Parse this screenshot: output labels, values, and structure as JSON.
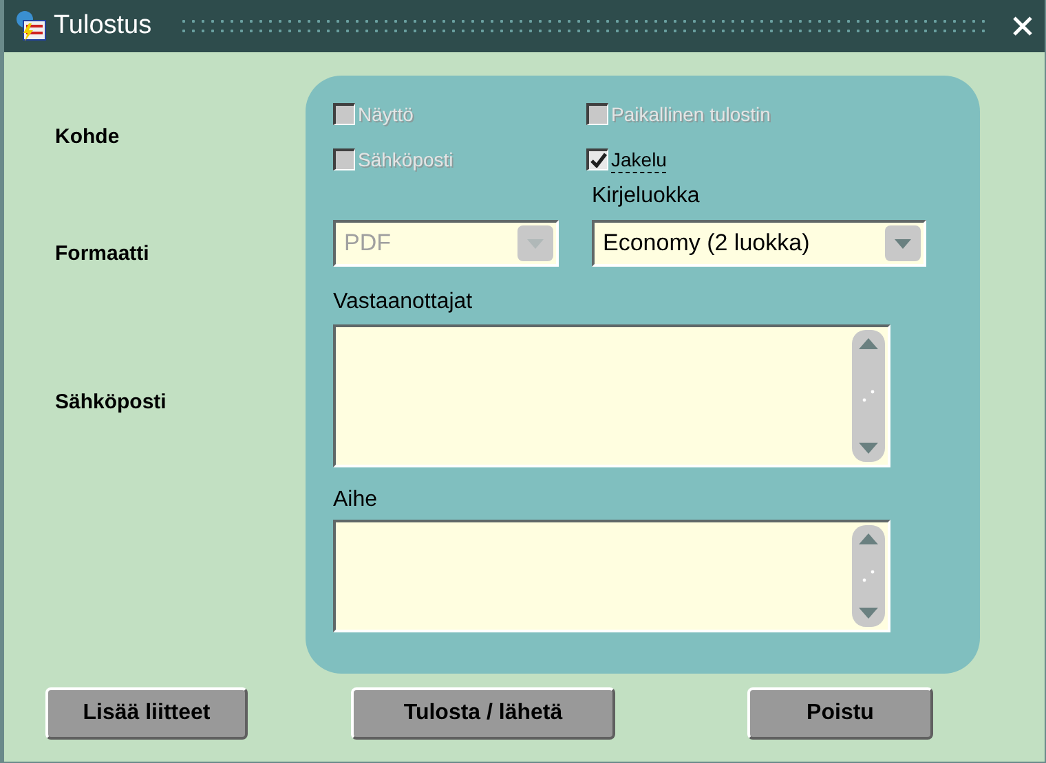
{
  "window": {
    "title": "Tulostus"
  },
  "rows": [
    {
      "label": "Kohde"
    },
    {
      "label": "Formaatti"
    },
    {
      "label": "Sähköposti"
    }
  ],
  "destinations": [
    {
      "label": "Näyttö",
      "checked": false,
      "disabled": true,
      "focused": false
    },
    {
      "label": "Paikallinen tulostin",
      "checked": false,
      "disabled": true,
      "focused": false
    },
    {
      "label": "Sähköposti",
      "checked": false,
      "disabled": true,
      "focused": false
    },
    {
      "label": "Jakelu",
      "checked": true,
      "disabled": false,
      "focused": true
    }
  ],
  "format": {
    "value": "PDF",
    "disabled": true
  },
  "letter_class": {
    "label": "Kirjeluokka",
    "value": "Economy (2 luokka)",
    "disabled": false
  },
  "recipients": {
    "label": "Vastaanottajat"
  },
  "subject": {
    "label": "Aihe"
  },
  "buttons": [
    "Lisää liitteet",
    "Tulosta / lähetä",
    "Poistu"
  ]
}
